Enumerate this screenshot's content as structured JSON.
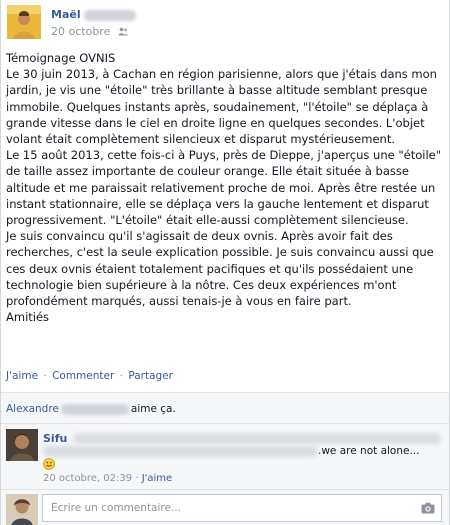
{
  "post": {
    "author": "Maël",
    "date": "20 octobre",
    "audience_icon": "friends-icon",
    "body": "Témoignage OVNIS\nLe 30 juin 2013, à Cachan en région parisienne, alors que j'étais dans mon jardin, je vis une \"étoile\" très brillante à basse altitude semblant presque immobile. Quelques instants après, soudainement, \"l'étoile\" se déplaça à grande vitesse dans le ciel en droite ligne en quelques secondes. L'objet volant était complètement silencieux et disparut mystérieusement.\nLe 15 août 2013, cette fois-ci à Puys, près de Dieppe, j'aperçus une \"étoile\" de taille assez importante de couleur orange. Elle était située à basse altitude et me paraissait relativement proche de moi. Après être restée un instant stationnaire, elle se déplaça vers la gauche lentement et disparut progressivement. \"L'étoile\" était elle-aussi complètement silencieuse.\nJe suis convaincu qu'il s'agissait de deux ovnis. Après avoir fait des recherches, c'est la seule explication possible. Je suis convaincu aussi que ces deux ovnis étaient totalement pacifiques et qu'ils possédaient une technologie bien supérieure à la nôtre. Ces deux expériences m'ont profondément marqués, aussi tenais-je à vous en faire part.\nAmitiés"
  },
  "actions": {
    "like": "J'aime",
    "comment": "Commenter",
    "share": "Partager",
    "separator": "·"
  },
  "likes": {
    "name": "Alexandre",
    "suffix": "aime ça."
  },
  "comment": {
    "author": "Sifu",
    "text": ".we are not alone...",
    "time": "20 octobre, 02:39",
    "separator": "·",
    "like": "J'aime",
    "emoji_icon": "smiley-icon"
  },
  "write_comment": {
    "placeholder": "Écrire un commentaire...",
    "camera_icon": "camera-icon"
  },
  "colors": {
    "link": "#3b5998",
    "meta": "#90949c",
    "ufi_bg": "#f6f7f9"
  }
}
